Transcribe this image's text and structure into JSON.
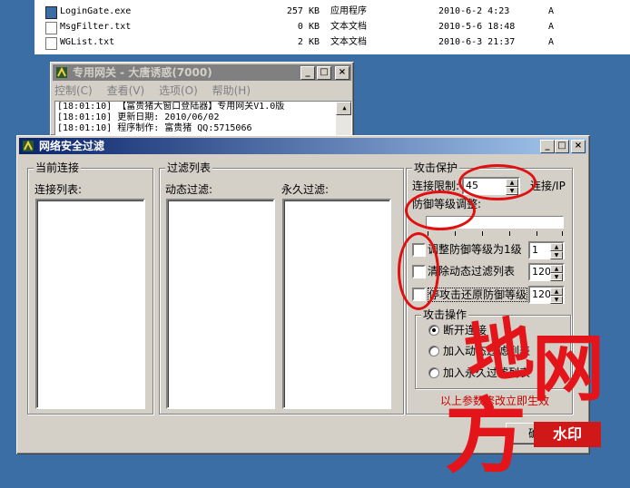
{
  "files": [
    {
      "name": "LoginGate.exe",
      "size": "257 KB",
      "type": "应用程序",
      "date": "2010-6-2 4:23",
      "attr": "A",
      "icon": "exe-icon"
    },
    {
      "name": "MsgFilter.txt",
      "size": "0 KB",
      "type": "文本文档",
      "date": "2010-5-6 18:48",
      "attr": "A",
      "icon": "text-file-icon"
    },
    {
      "name": "WGList.txt",
      "size": "2 KB",
      "type": "文本文档",
      "date": "2010-6-3 21:37",
      "attr": "A",
      "icon": "text-file-icon"
    }
  ],
  "gate_window": {
    "title": "专用网关 - 大唐诱惑(7000)",
    "menu": [
      "控制(C)",
      "查看(V)",
      "选项(O)",
      "帮助(H)"
    ],
    "log": [
      "[18:01:10] 【富贵猪大窗口登陆器】专用网关V1.0版",
      "[18:01:10] 更新日期: 2010/06/02",
      "[18:01:10] 程序制作: 富贵猪 QQ:5715066"
    ]
  },
  "main_window": {
    "title": "网络安全过滤",
    "current_conn": {
      "group": "当前连接",
      "list_label": "连接列表:"
    },
    "filter_list": {
      "group": "过滤列表",
      "dynamic_label": "动态过滤:",
      "permanent_label": "永久过滤:"
    },
    "attack_protect": {
      "group": "攻击保护",
      "conn_limit_label": "连接限制:",
      "conn_limit_value": "45",
      "conn_limit_unit": "连接/IP",
      "defense_level_label": "防御等级调整:",
      "options": [
        {
          "label": "调整防御等级为1级",
          "checked": false,
          "value": "1"
        },
        {
          "label": "清除动态过滤列表",
          "checked": false,
          "value": "120"
        },
        {
          "label": "停攻击还原防御等级",
          "checked": false,
          "value": "120"
        }
      ]
    },
    "attack_ops": {
      "group": "攻击操作",
      "radios": [
        {
          "label": "断开连接",
          "selected": true
        },
        {
          "label": "加入动态过滤列表",
          "selected": false
        },
        {
          "label": "加入永久过滤列表",
          "selected": false
        }
      ]
    },
    "note": "以上参数修改立即生效",
    "ok_button": "确定"
  },
  "watermark": {
    "big1": "地",
    "big2": "网",
    "big3": "方",
    "badge": "水印"
  },
  "colors": {
    "desktop": "#3a6ea5",
    "title_active": "#0a246a",
    "annotation": "#e01010",
    "note": "#cc0000"
  }
}
